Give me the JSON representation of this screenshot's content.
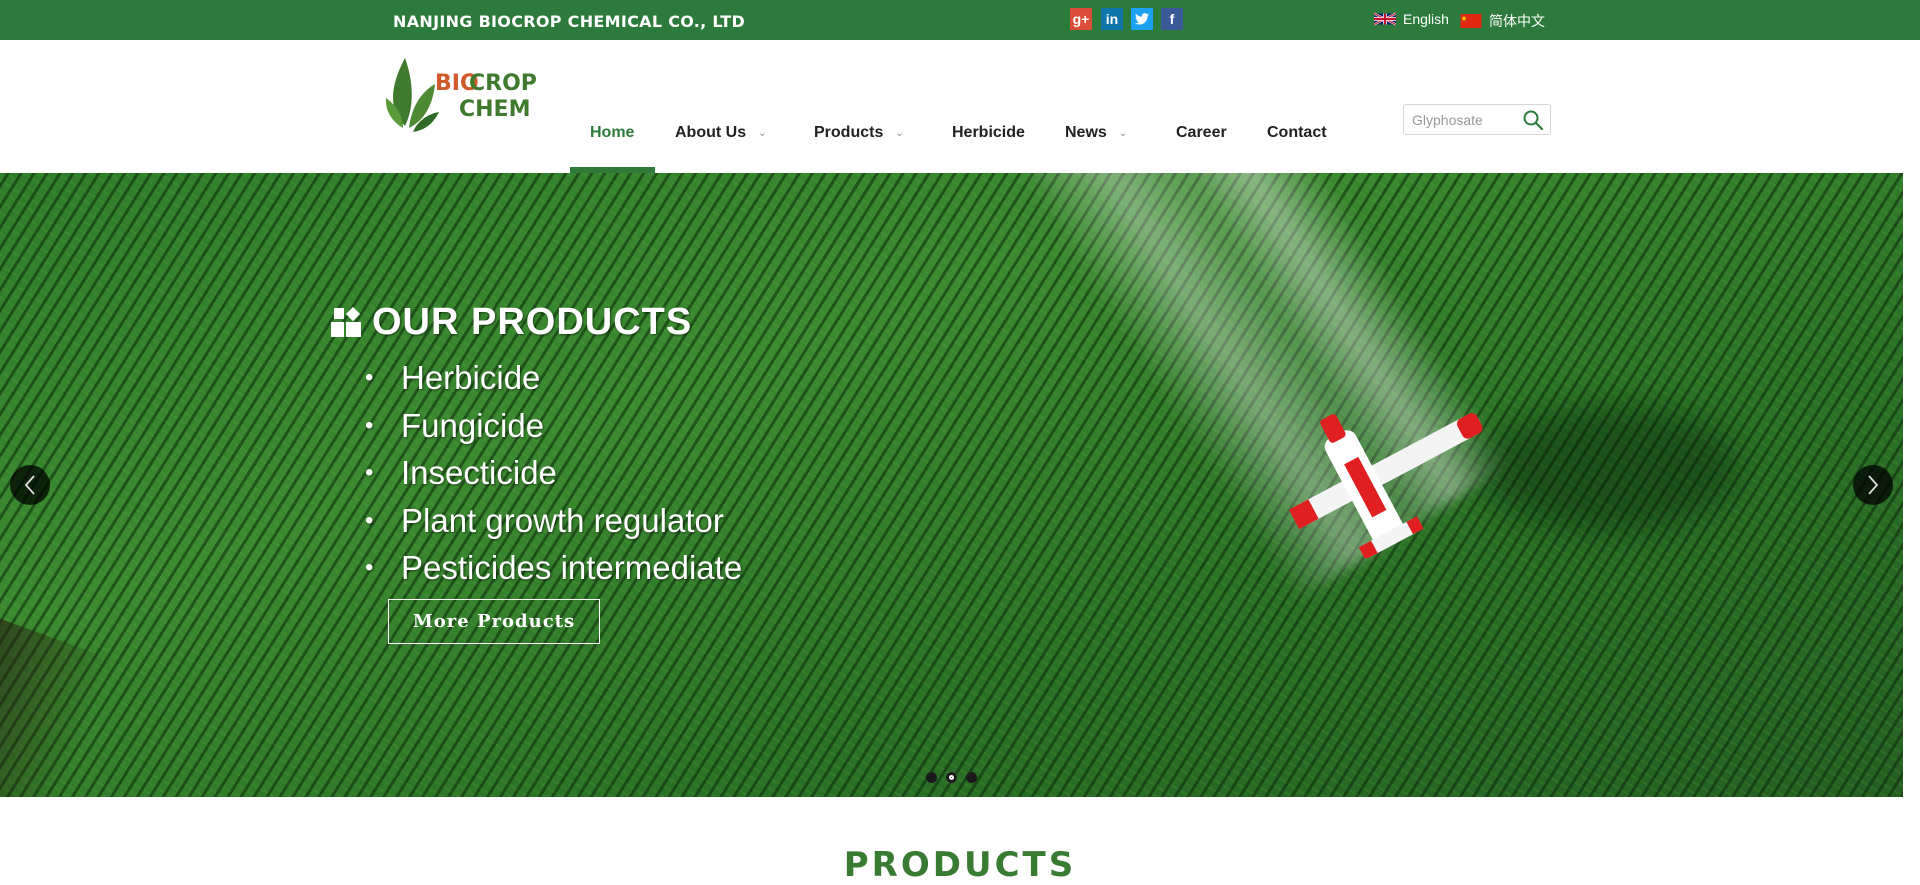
{
  "topbar": {
    "company_name": "NANJING BIOCROP CHEMICAL CO., LTD",
    "social": [
      {
        "icon": "google-plus-icon",
        "glyph": "g+",
        "color": "#dd4b39"
      },
      {
        "icon": "linkedin-icon",
        "glyph": "in",
        "color": "#0e76a8"
      },
      {
        "icon": "twitter-icon",
        "glyph": "t",
        "color": "#1da1f2"
      },
      {
        "icon": "facebook-icon",
        "glyph": "f",
        "color": "#3b5998"
      }
    ],
    "languages": [
      {
        "label": "English",
        "flag": "uk-flag-icon"
      },
      {
        "label": "简体中文",
        "flag": "china-flag-icon"
      }
    ]
  },
  "header": {
    "logo": {
      "line1_a": "BIO",
      "line1_b": "CROP",
      "line2": "CHEM"
    },
    "nav": [
      {
        "label": "Home",
        "active": true,
        "dropdown": false
      },
      {
        "label": "About Us",
        "active": false,
        "dropdown": true
      },
      {
        "label": "Products",
        "active": false,
        "dropdown": true
      },
      {
        "label": "Herbicide",
        "active": false,
        "dropdown": false
      },
      {
        "label": "News",
        "active": false,
        "dropdown": true
      },
      {
        "label": "Career",
        "active": false,
        "dropdown": false
      },
      {
        "label": "Contact",
        "active": false,
        "dropdown": false
      }
    ],
    "search": {
      "placeholder": "Glyphosate",
      "value": ""
    }
  },
  "hero": {
    "heading": "OUR PRODUCTS",
    "items": [
      "Herbicide",
      "Fungicide",
      "Insecticide",
      "Plant growth regulator",
      "Pesticides intermediate"
    ],
    "bullet": "•",
    "button_label": "More Products",
    "slides": 3,
    "active_slide": 1
  },
  "section": {
    "title": "PRODUCTS"
  },
  "colors": {
    "brand_green": "#2c7a3c",
    "nav_active": "#2f7a3b",
    "logo_orange": "#d05a2a"
  }
}
